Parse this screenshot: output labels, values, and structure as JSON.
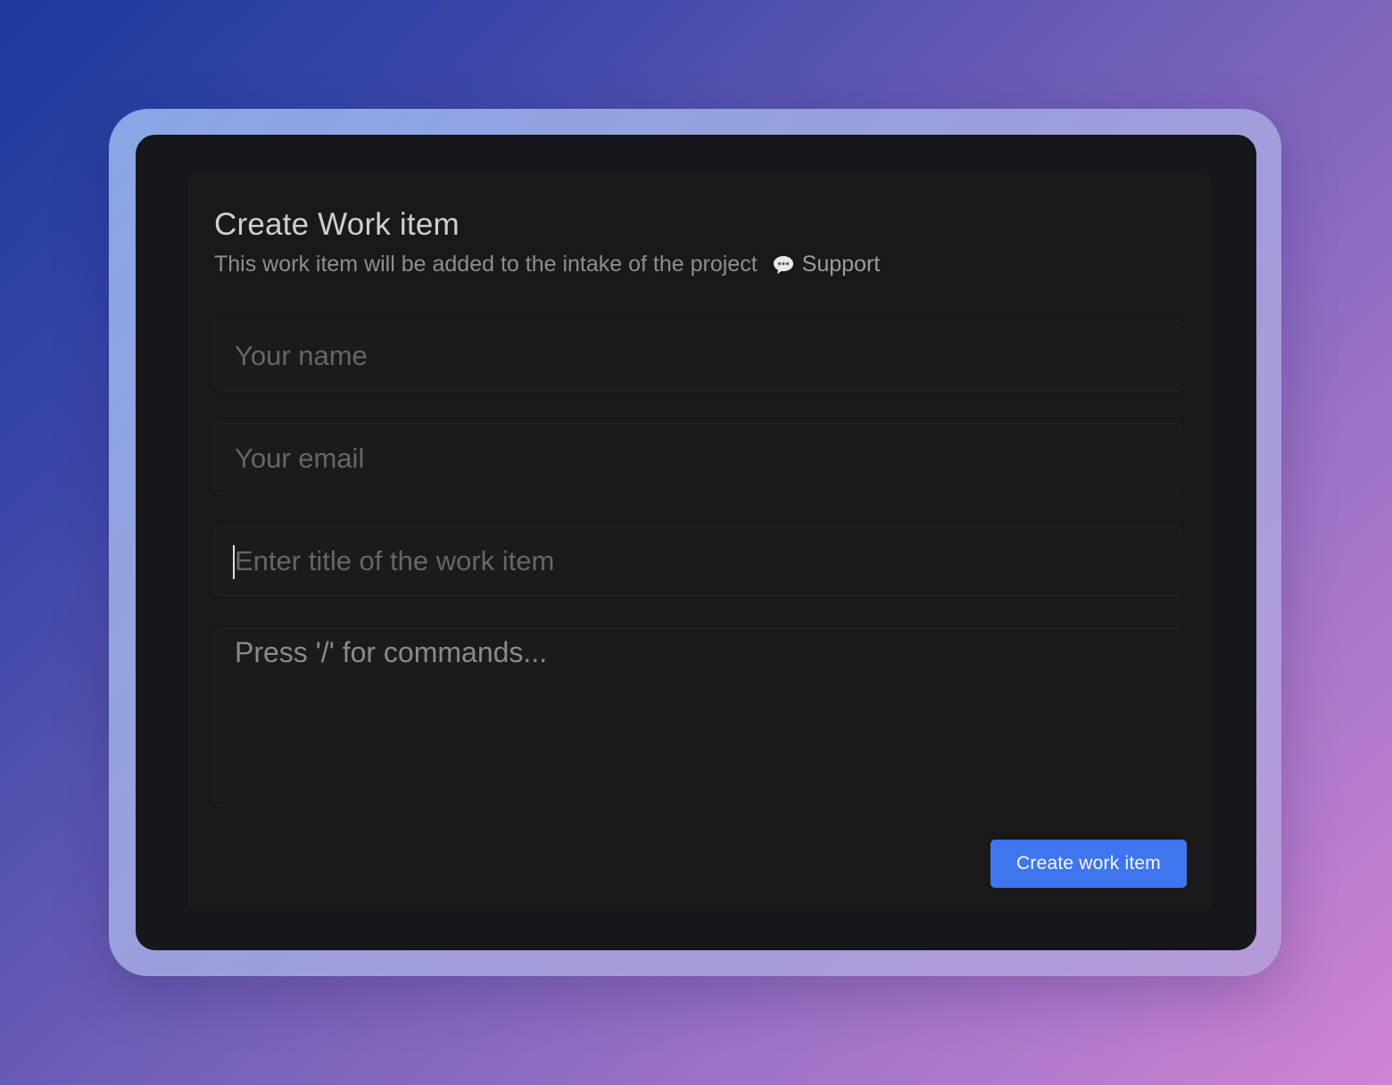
{
  "form": {
    "title": "Create Work item",
    "subtitle": "This work item will be added to the intake of the project",
    "support_label": "Support",
    "support_icon": "speech-bubble-icon",
    "fields": {
      "name_placeholder": "Your name",
      "email_placeholder": "Your email",
      "title_placeholder": "Enter title of the work item",
      "description_placeholder": "Press '/' for commands..."
    },
    "submit_label": "Create work item"
  },
  "colors": {
    "accent": "#3f76f0",
    "panel_bg": "#191919",
    "screen_bg": "#15171c"
  }
}
